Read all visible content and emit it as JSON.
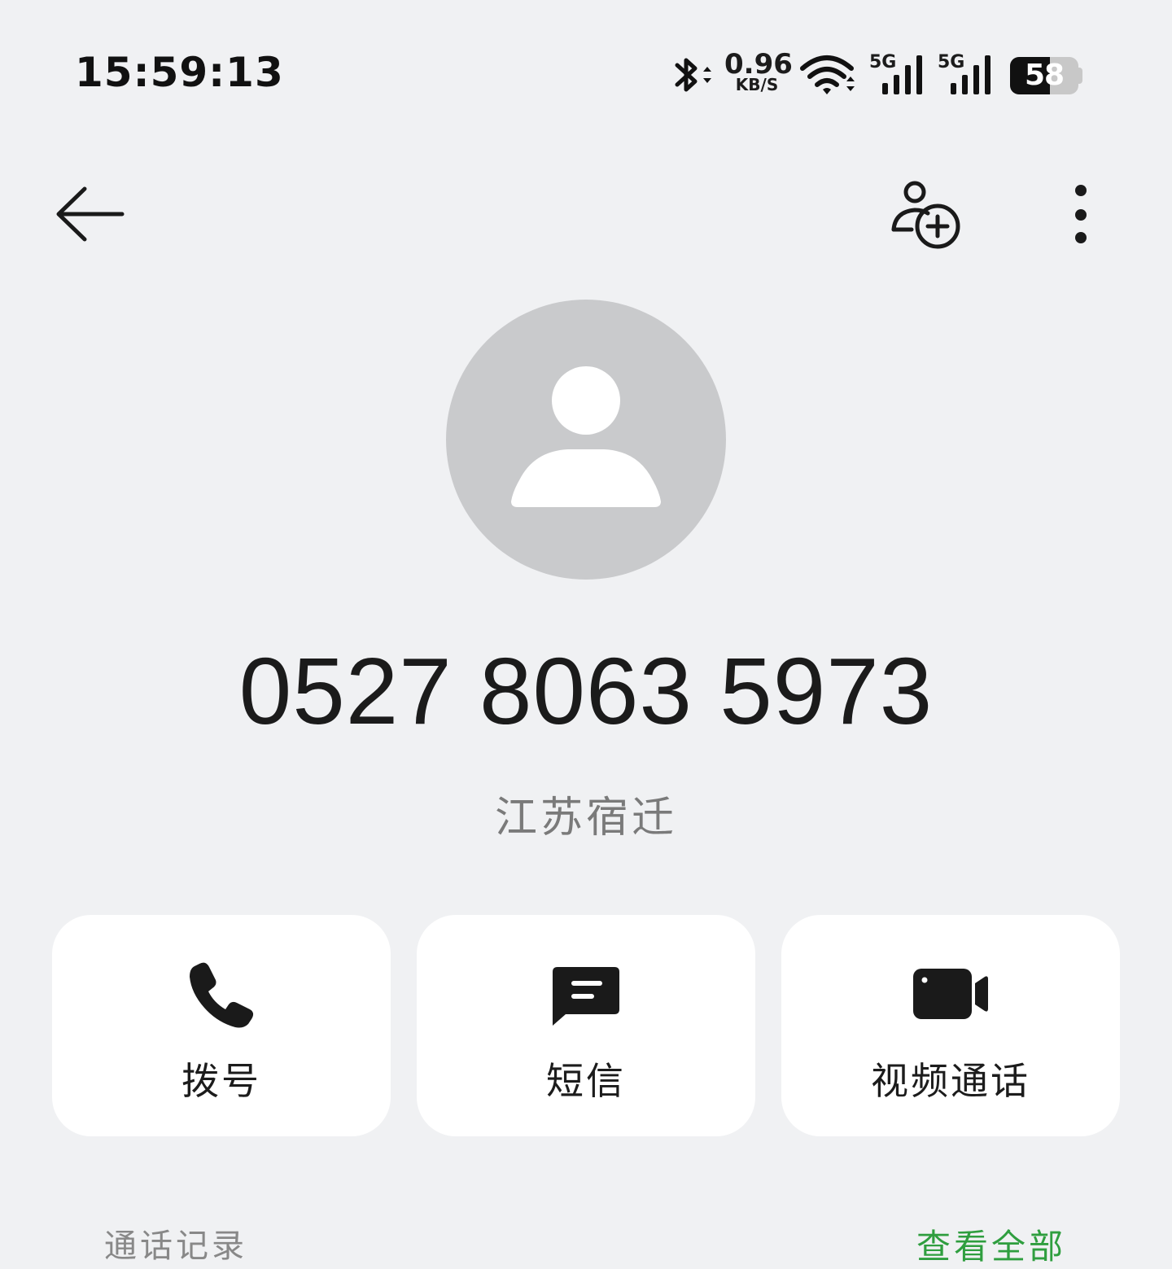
{
  "status_bar": {
    "time": "15:59:13",
    "net_speed_value": "0.96",
    "net_speed_unit": "KB/S",
    "sim1_label": "5G",
    "sim2_label": "5G",
    "battery_level": "58",
    "icons": [
      "bluetooth-icon",
      "wifi-icon",
      "signal-icon",
      "battery-icon"
    ]
  },
  "toolbar": {
    "icons": [
      "back-arrow-icon",
      "add-contact-icon",
      "more-vertical-icon"
    ]
  },
  "contact": {
    "phone_number": "0527 8063 5973",
    "location": "江苏宿迁"
  },
  "actions": [
    {
      "label": "拨号",
      "icon": "phone-icon"
    },
    {
      "label": "短信",
      "icon": "message-icon"
    },
    {
      "label": "视频通话",
      "icon": "video-camera-icon"
    }
  ],
  "call_log": {
    "title": "通话记录",
    "view_all": "查看全部"
  },
  "colors": {
    "background": "#f0f1f3",
    "card": "#ffffff",
    "accent": "#2f9e3f",
    "avatar": "#c9cacc"
  }
}
